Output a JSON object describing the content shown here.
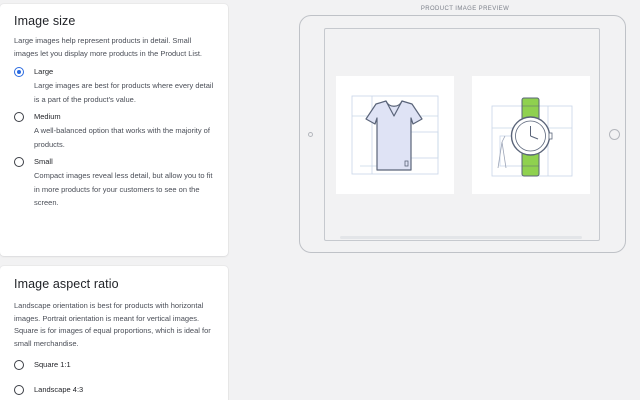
{
  "image_size": {
    "title": "Image size",
    "description": "Large images help represent products in detail. Small images let you display more products in the Product List.",
    "options": [
      {
        "label": "Large",
        "description": "Large images are best for products where every detail is a part of the product's value.",
        "selected": true
      },
      {
        "label": "Medium",
        "description": "A well-balanced option that works with the majority of products.",
        "selected": false
      },
      {
        "label": "Small",
        "description": "Compact images reveal less detail, but allow you to fit in more products for your customers to see on the screen.",
        "selected": false
      }
    ]
  },
  "aspect_ratio": {
    "title": "Image aspect ratio",
    "description": "Landscape orientation is best for products with horizontal images. Portrait orientation is meant for vertical images. Square is for images of equal proportions, which is ideal for small merchandise.",
    "options": [
      {
        "label": "Square 1:1",
        "selected": false
      },
      {
        "label": "Landscape 4:3",
        "selected": false
      }
    ]
  },
  "preview": {
    "title": "PRODUCT IMAGE PREVIEW",
    "products": [
      {
        "icon": "tshirt-icon"
      },
      {
        "icon": "watch-icon"
      }
    ]
  },
  "colors": {
    "accent": "#2b6be0",
    "tshirt_fill": "#dfe3f5",
    "watch_strap": "#8fd14f",
    "line": "#5a6479"
  }
}
